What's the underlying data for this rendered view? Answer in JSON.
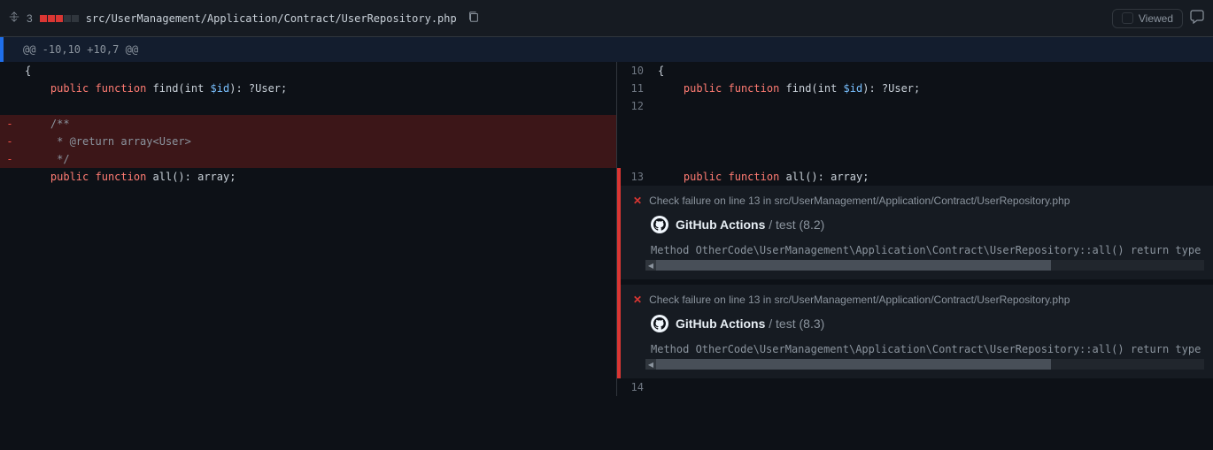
{
  "header": {
    "change_count": "3",
    "file_path": "src/UserManagement/Application/Contract/UserRepository.php",
    "viewed_label": "Viewed"
  },
  "hunk": "@@ -10,10 +10,7 @@",
  "left": {
    "rows": [
      {
        "num": "",
        "marker": "",
        "cls": "",
        "html": "{"
      },
      {
        "num": "",
        "marker": "",
        "cls": "",
        "html": "    <span class='kw-public'>public</span> <span class='kw-function'>function</span> find(int <span class='kw-var'>$id</span>): ?User;"
      },
      {
        "num": "",
        "marker": "",
        "cls": "",
        "html": ""
      },
      {
        "num": "",
        "marker": "-",
        "cls": "row-deleted",
        "html": "    <span class='comment'>/**</span>"
      },
      {
        "num": "",
        "marker": "-",
        "cls": "row-deleted",
        "html": "     <span class='comment'>* @return array&lt;User&gt;</span>"
      },
      {
        "num": "",
        "marker": "-",
        "cls": "row-deleted",
        "html": "     <span class='comment'>*/</span>"
      },
      {
        "num": "",
        "marker": "",
        "cls": "",
        "html": "    <span class='kw-public'>public</span> <span class='kw-function'>function</span> all(): array;"
      }
    ]
  },
  "right": {
    "rows": [
      {
        "num": "10",
        "cls": "",
        "html": "{"
      },
      {
        "num": "11",
        "cls": "",
        "html": "    <span class='kw-public'>public</span> <span class='kw-function'>function</span> find(int <span class='kw-var'>$id</span>): ?User;"
      },
      {
        "num": "12",
        "cls": "",
        "html": ""
      }
    ],
    "row_all": {
      "num": "13",
      "cls": "row-added-right",
      "html": "    <span class='kw-public'>public</span> <span class='kw-function'>function</span> all(): array;"
    },
    "row_after": {
      "num": "14",
      "cls": "",
      "html": ""
    }
  },
  "annotations": [
    {
      "title": "Check failure on line 13 in src/UserManagement/Application/Contract/UserRepository.php",
      "source_name": "GitHub Actions",
      "source_suffix": " / test (8.2)",
      "message": "Method OtherCode\\UserManagement\\Application\\Contract\\UserRepository::all() return type ha"
    },
    {
      "title": "Check failure on line 13 in src/UserManagement/Application/Contract/UserRepository.php",
      "source_name": "GitHub Actions",
      "source_suffix": " / test (8.3)",
      "message": "Method OtherCode\\UserManagement\\Application\\Contract\\UserRepository::all() return type ha"
    }
  ]
}
